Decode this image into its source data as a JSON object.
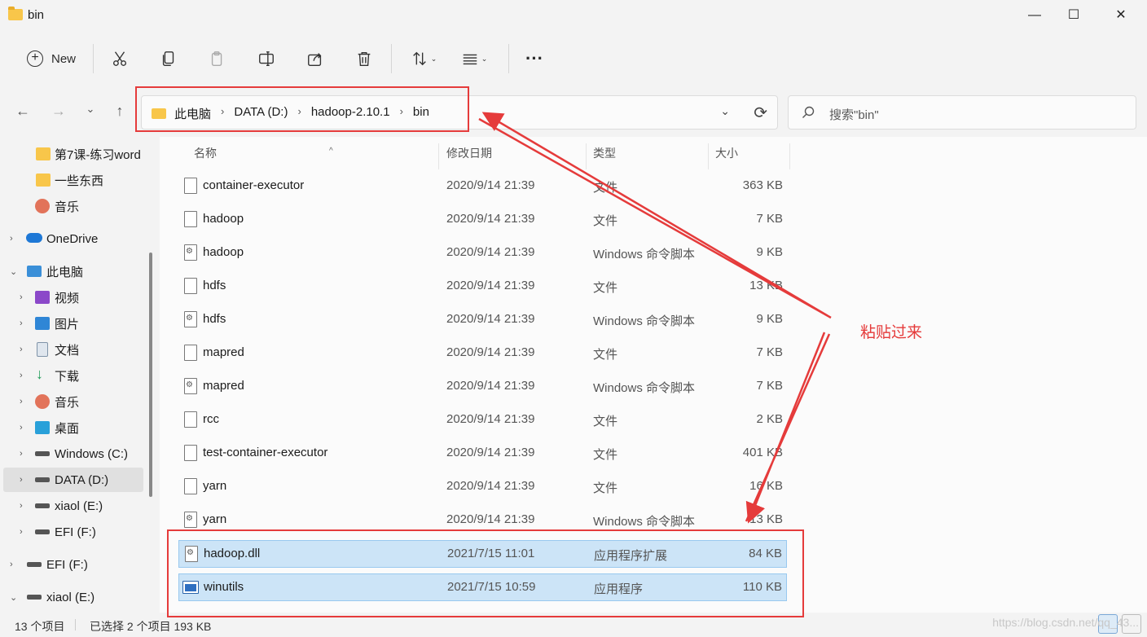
{
  "window": {
    "title": "bin",
    "controls": {
      "minimize": "—",
      "maximize": "☐",
      "close": "✕"
    }
  },
  "toolbar": {
    "new_label": "New",
    "icons": [
      "cut-icon",
      "copy-icon",
      "paste-icon",
      "rename-icon",
      "share-icon",
      "delete-icon",
      "sort-icon",
      "view-icon",
      "more-icon"
    ]
  },
  "address": {
    "crumbs": [
      "此电脑",
      "DATA (D:)",
      "hadoop-2.10.1",
      "bin"
    ]
  },
  "search": {
    "placeholder": "搜索\"bin\""
  },
  "sidebar": {
    "items": [
      {
        "label": "第7课-练习word",
        "icon": "folder-icon"
      },
      {
        "label": "一些东西",
        "icon": "folder-icon"
      },
      {
        "label": "音乐",
        "icon": "music-icon"
      },
      {
        "label": "OneDrive",
        "icon": "cloud-icon"
      },
      {
        "label": "此电脑",
        "icon": "computer-icon"
      },
      {
        "label": "视频",
        "icon": "video-icon"
      },
      {
        "label": "图片",
        "icon": "pictures-icon"
      },
      {
        "label": "文档",
        "icon": "documents-icon"
      },
      {
        "label": "下载",
        "icon": "download-icon"
      },
      {
        "label": "音乐",
        "icon": "music-icon"
      },
      {
        "label": "桌面",
        "icon": "desktop-icon"
      },
      {
        "label": "Windows (C:)",
        "icon": "drive-icon"
      },
      {
        "label": "DATA (D:)",
        "icon": "drive-icon",
        "selected": true
      },
      {
        "label": "xiaol (E:)",
        "icon": "drive-icon"
      },
      {
        "label": "EFI (F:)",
        "icon": "drive-icon"
      },
      {
        "label": "EFI (F:)",
        "icon": "drive-icon"
      },
      {
        "label": "xiaol (E:)",
        "icon": "drive-icon"
      }
    ]
  },
  "columns": {
    "name": "名称",
    "date": "修改日期",
    "type": "类型",
    "size": "大小"
  },
  "files": [
    {
      "name": "container-executor",
      "date": "2020/9/14 21:39",
      "type": "文件",
      "size": "363 KB",
      "icon": "file-icon"
    },
    {
      "name": "hadoop",
      "date": "2020/9/14 21:39",
      "type": "文件",
      "size": "7 KB",
      "icon": "file-icon"
    },
    {
      "name": "hadoop",
      "date": "2020/9/14 21:39",
      "type": "Windows 命令脚本",
      "size": "9 KB",
      "icon": "script-icon"
    },
    {
      "name": "hdfs",
      "date": "2020/9/14 21:39",
      "type": "文件",
      "size": "13 KB",
      "icon": "file-icon"
    },
    {
      "name": "hdfs",
      "date": "2020/9/14 21:39",
      "type": "Windows 命令脚本",
      "size": "9 KB",
      "icon": "script-icon"
    },
    {
      "name": "mapred",
      "date": "2020/9/14 21:39",
      "type": "文件",
      "size": "7 KB",
      "icon": "file-icon"
    },
    {
      "name": "mapred",
      "date": "2020/9/14 21:39",
      "type": "Windows 命令脚本",
      "size": "7 KB",
      "icon": "script-icon"
    },
    {
      "name": "rcc",
      "date": "2020/9/14 21:39",
      "type": "文件",
      "size": "2 KB",
      "icon": "file-icon"
    },
    {
      "name": "test-container-executor",
      "date": "2020/9/14 21:39",
      "type": "文件",
      "size": "401 KB",
      "icon": "file-icon"
    },
    {
      "name": "yarn",
      "date": "2020/9/14 21:39",
      "type": "文件",
      "size": "16 KB",
      "icon": "file-icon"
    },
    {
      "name": "yarn",
      "date": "2020/9/14 21:39",
      "type": "Windows 命令脚本",
      "size": "13 KB",
      "icon": "script-icon"
    },
    {
      "name": "hadoop.dll",
      "date": "2021/7/15 11:01",
      "type": "应用程序扩展",
      "size": "84 KB",
      "icon": "dll-icon",
      "selected": true
    },
    {
      "name": "winutils",
      "date": "2021/7/15 10:59",
      "type": "应用程序",
      "size": "110 KB",
      "icon": "exe-icon",
      "selected": true
    }
  ],
  "status": {
    "count": "13 个项目",
    "selection": "已选择 2 个项目  193 KB"
  },
  "annotation": {
    "label": "粘贴过来",
    "color": "#e53b3b"
  },
  "watermark": "https://blog.csdn.net/qq_43..."
}
